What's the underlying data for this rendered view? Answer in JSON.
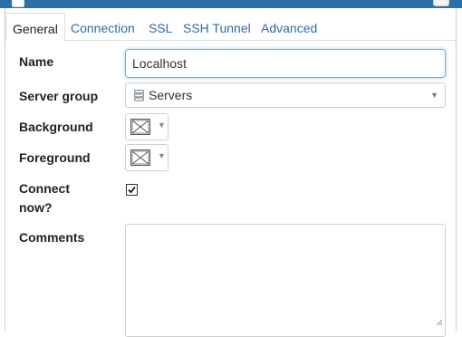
{
  "tabs": [
    {
      "label": "General",
      "active": true
    },
    {
      "label": "Connection"
    },
    {
      "label": "SSL"
    },
    {
      "label": "SSH Tunnel"
    },
    {
      "label": "Advanced"
    }
  ],
  "form": {
    "name": {
      "label": "Name",
      "value": "Localhost"
    },
    "server_group": {
      "label": "Server group",
      "value": "Servers",
      "icon": "server-group-icon"
    },
    "background": {
      "label": "Background",
      "icon": "no-color-swatch-icon"
    },
    "foreground": {
      "label": "Foreground",
      "icon": "no-color-swatch-icon"
    },
    "connect_now": {
      "label_line1": "Connect",
      "label_line2": "now?",
      "checked": true
    },
    "comments": {
      "label": "Comments",
      "value": ""
    }
  },
  "colors": {
    "accent": "#2c6cae",
    "titlebar": "#2f6fa8",
    "focus_border": "#66afe9"
  }
}
